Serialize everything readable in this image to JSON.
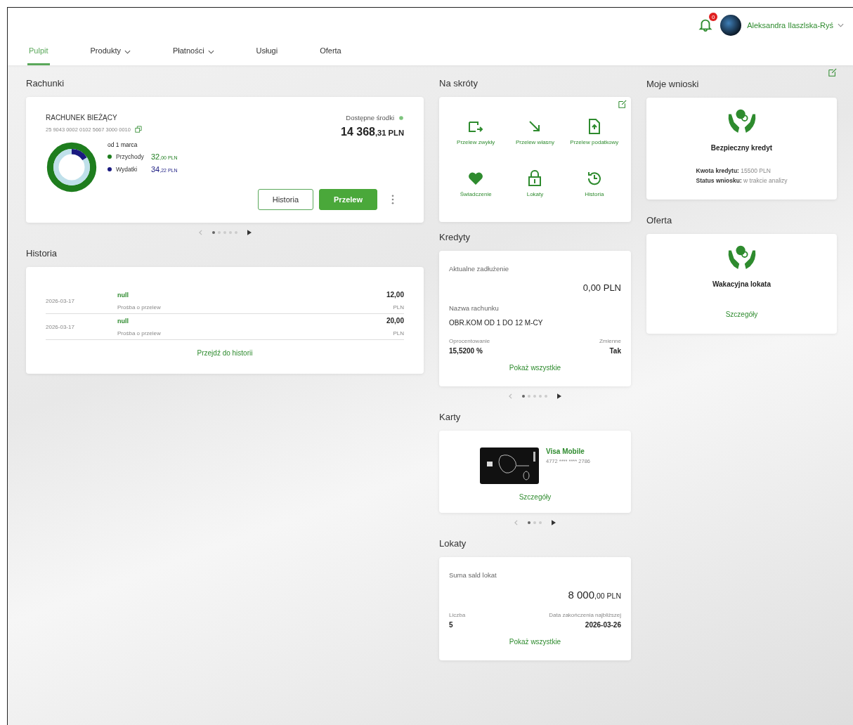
{
  "header": {
    "notification_badge": "0",
    "user_name": "Aleksandra Ilaszlska-Ryś"
  },
  "tabs": [
    {
      "label": "Pulpit",
      "selected": true,
      "dropdown": false
    },
    {
      "label": "Produkty",
      "selected": false,
      "dropdown": true
    },
    {
      "label": "Płatności",
      "selected": false,
      "dropdown": true
    },
    {
      "label": "Usługi",
      "selected": false,
      "dropdown": false
    },
    {
      "label": "Oferta",
      "selected": false,
      "dropdown": false
    }
  ],
  "accounts": {
    "title": "Rachunki",
    "name": "RACHUNEK BIEŻĄCY",
    "number": "25 9043 0002 0102 5667 3000 0010",
    "available_label": "Dostępne środki",
    "balance": {
      "main": "14 368",
      "fraction": ",31",
      "currency": "PLN"
    },
    "period": "od 1 marca",
    "legend": [
      {
        "label": "Przychody",
        "color": "#1e7d1e",
        "amount": {
          "main": "32",
          "fraction": ",00",
          "currency": "PLN"
        }
      },
      {
        "label": "Wydatki",
        "color": "#1a1a80",
        "amount": {
          "main": "34",
          "fraction": ",22",
          "currency": "PLN"
        }
      }
    ],
    "buttons": [
      {
        "label": "Historia",
        "kind": "outline"
      },
      {
        "label": "Przelew",
        "kind": "primary"
      }
    ],
    "pager": [
      {
        "selected": true
      },
      {
        "selected": false
      },
      {
        "selected": false
      },
      {
        "selected": false
      },
      {
        "selected": false
      }
    ]
  },
  "history": {
    "title": "Historia",
    "rows": [
      {
        "date": "2026-03-17",
        "title": "null",
        "subtitle": "Prośba o przelew",
        "amount": "12,00",
        "currency": "PLN"
      },
      {
        "date": "2026-03-17",
        "title": "null",
        "subtitle": "Prośba o przelew",
        "amount": "20,00",
        "currency": "PLN"
      }
    ],
    "link": "Przejdź do historii"
  },
  "shortcuts": {
    "title": "Na skróty",
    "items": [
      {
        "label": "Przelew zwykły",
        "kind": "transfer"
      },
      {
        "label": "Przelew własny",
        "kind": "arrow"
      },
      {
        "label": "Przelew podatkowy",
        "kind": "document"
      },
      {
        "label": "Świadczenie",
        "kind": "heart"
      },
      {
        "label": "Lokaty",
        "kind": "lock"
      },
      {
        "label": "Historia",
        "kind": "history"
      }
    ]
  },
  "credits": {
    "title": "Kredyty",
    "debt_label": "Aktualne zadłużenie",
    "debt": "0,00 PLN",
    "account_label": "Nazwa rachunku",
    "account": "OBR.KOM OD 1 DO 12 M-CY",
    "rate_label": "Oprocentowanie",
    "rate": "15,5200 %",
    "variable_label": "Zmienne",
    "variable": "Tak",
    "link": "Pokaż wszystkie",
    "pager": [
      {
        "selected": true
      },
      {
        "selected": false
      },
      {
        "selected": false
      },
      {
        "selected": false
      },
      {
        "selected": false
      }
    ]
  },
  "cards": {
    "title": "Karty",
    "name": "Visa Mobile",
    "number": "4772 **** **** 2786",
    "link": "Szczegóły",
    "pager": [
      {
        "selected": true
      },
      {
        "selected": false
      },
      {
        "selected": false
      }
    ]
  },
  "deposits": {
    "title": "Lokaty",
    "sum_label": "Suma sald lokat",
    "sum": {
      "main": "8 000",
      "fraction": ",00",
      "currency": "PLN"
    },
    "count_label": "Liczba",
    "count": "5",
    "end_label": "Data zakończenia najbliższej",
    "end": "2026-03-26",
    "link": "Pokaż wszystkie"
  },
  "applications": {
    "title": "Moje wnioski",
    "name": "Bezpieczny kredyt",
    "lines": [
      {
        "label": "Kwota kredytu:",
        "value": "15500 PLN"
      },
      {
        "label": "Status wniosku:",
        "value": "w trakcie analizy"
      }
    ]
  },
  "offer": {
    "title": "Oferta",
    "name": "Wakacyjna lokata",
    "link": "Szczegóły"
  }
}
